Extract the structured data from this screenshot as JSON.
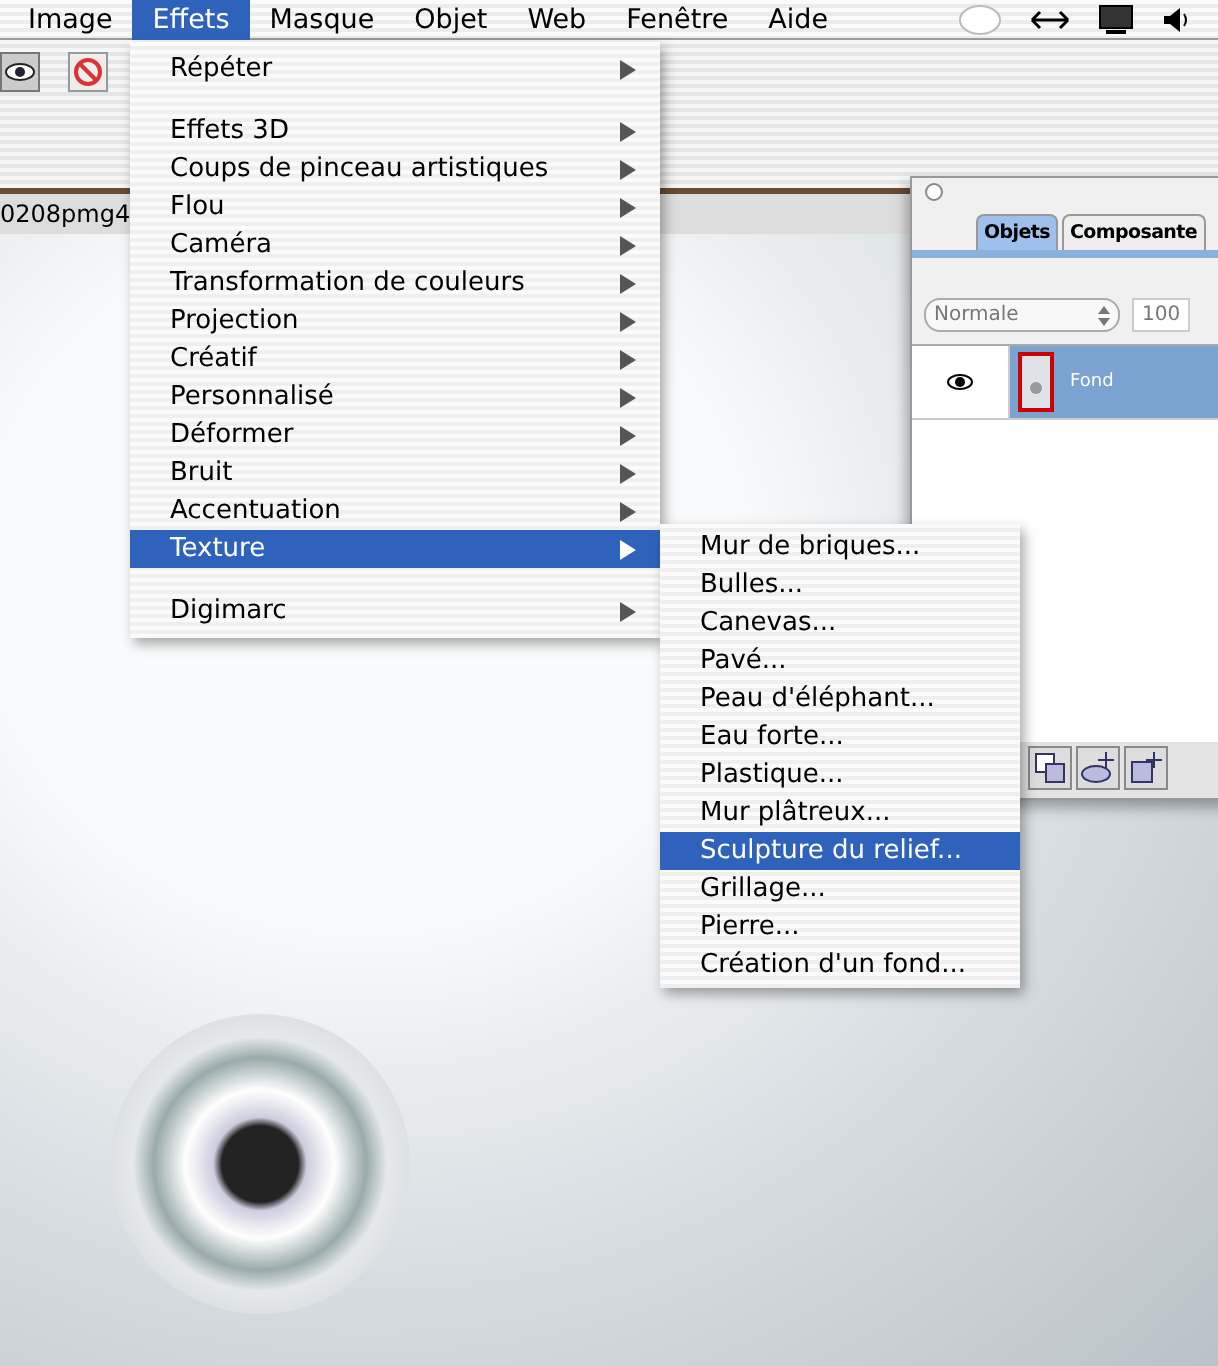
{
  "menu_bar": {
    "items": [
      {
        "label": "Image",
        "selected": false
      },
      {
        "label": "Effets",
        "selected": true
      },
      {
        "label": "Masque",
        "selected": false
      },
      {
        "label": "Objet",
        "selected": false
      },
      {
        "label": "Web",
        "selected": false
      },
      {
        "label": "Fenêtre",
        "selected": false
      },
      {
        "label": "Aide",
        "selected": false
      }
    ]
  },
  "document": {
    "title": "0208pmg4"
  },
  "layers_panel": {
    "tabs": [
      {
        "label": "Objets",
        "selected": true
      },
      {
        "label": "Composante",
        "selected": false
      }
    ],
    "blend_mode": "Normale",
    "opacity": "100",
    "layers": [
      {
        "name": "Fond",
        "selected": true,
        "visible": true
      }
    ]
  },
  "effects_menu": {
    "groups": [
      [
        {
          "label": "Répéter",
          "has_submenu": true,
          "selected": false
        }
      ],
      [
        {
          "label": "Effets 3D",
          "has_submenu": true,
          "selected": false
        },
        {
          "label": "Coups de pinceau artistiques",
          "has_submenu": true,
          "selected": false
        },
        {
          "label": "Flou",
          "has_submenu": true,
          "selected": false
        },
        {
          "label": "Caméra",
          "has_submenu": true,
          "selected": false
        },
        {
          "label": "Transformation de couleurs",
          "has_submenu": true,
          "selected": false
        },
        {
          "label": "Projection",
          "has_submenu": true,
          "selected": false
        },
        {
          "label": "Créatif",
          "has_submenu": true,
          "selected": false
        },
        {
          "label": "Personnalisé",
          "has_submenu": true,
          "selected": false
        },
        {
          "label": "Déformer",
          "has_submenu": true,
          "selected": false
        },
        {
          "label": "Bruit",
          "has_submenu": true,
          "selected": false
        },
        {
          "label": "Accentuation",
          "has_submenu": true,
          "selected": false
        },
        {
          "label": "Texture",
          "has_submenu": true,
          "selected": true
        }
      ],
      [
        {
          "label": "Digimarc",
          "has_submenu": true,
          "selected": false
        }
      ]
    ]
  },
  "texture_submenu": {
    "items": [
      {
        "label": "Mur de briques...",
        "selected": false
      },
      {
        "label": "Bulles...",
        "selected": false
      },
      {
        "label": "Canevas...",
        "selected": false
      },
      {
        "label": "Pavé...",
        "selected": false
      },
      {
        "label": "Peau d'éléphant...",
        "selected": false
      },
      {
        "label": "Eau forte...",
        "selected": false
      },
      {
        "label": "Plastique...",
        "selected": false
      },
      {
        "label": "Mur plâtreux...",
        "selected": false
      },
      {
        "label": "Sculpture du relief...",
        "selected": true
      },
      {
        "label": "Grillage...",
        "selected": false
      },
      {
        "label": "Pierre...",
        "selected": false
      },
      {
        "label": "Création d'un fond...",
        "selected": false
      }
    ]
  }
}
